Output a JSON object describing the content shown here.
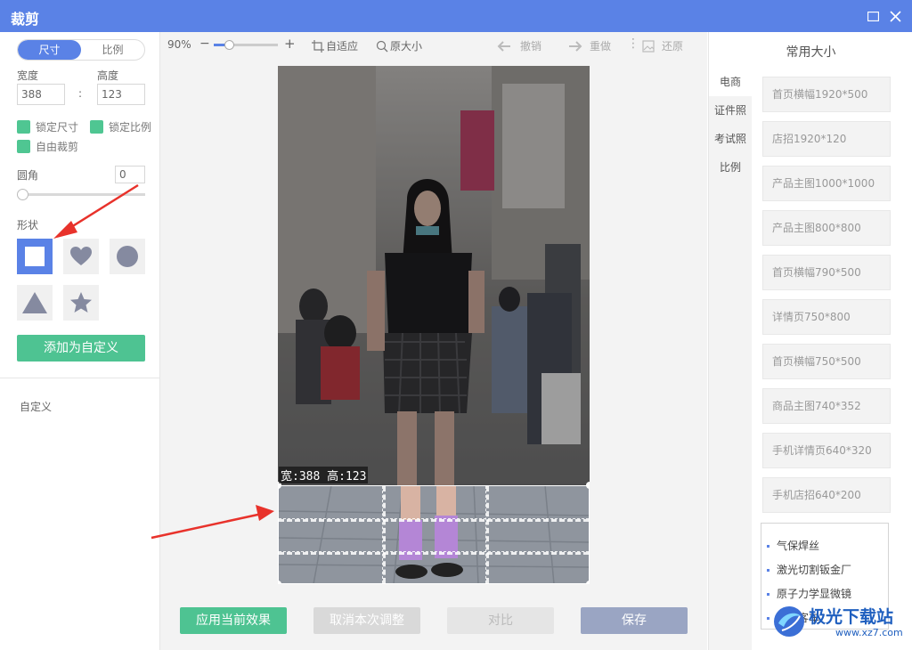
{
  "window": {
    "title": "裁剪"
  },
  "left": {
    "segment": {
      "size_label": "尺寸",
      "ratio_label": "比例"
    },
    "width_label": "宽度",
    "height_label": "高度",
    "width_value": "388",
    "height_value": "123",
    "separator": ":",
    "checks": {
      "lock_size": "锁定尺寸",
      "lock_ratio": "锁定比例",
      "free_crop": "自由裁剪"
    },
    "corner_label": "圆角",
    "corner_value": "0",
    "shape_label": "形状",
    "add_custom": "添加为自定义",
    "custom_label": "自定义"
  },
  "toolbar": {
    "zoom": "90%",
    "zoom_minus": "−",
    "zoom_plus": "+",
    "fit": "自适应",
    "original_size": "原大小",
    "undo": "撤销",
    "redo": "重做",
    "restore": "还原"
  },
  "canvas": {
    "size_readout": "宽:388 高:123"
  },
  "actions": {
    "apply": "应用当前效果",
    "cancel": "取消本次调整",
    "compare": "对比",
    "save": "保存"
  },
  "right": {
    "title": "常用大小",
    "tabs": [
      "电商",
      "证件照",
      "考试照",
      "比例"
    ],
    "presets": [
      "首页横幅1920*500",
      "店招1920*120",
      "产品主图1000*1000",
      "产品主图800*800",
      "首页横幅790*500",
      "详情页750*800",
      "首页横幅750*500",
      "商品主图740*352",
      "手机详情页640*320",
      "手机店招640*200"
    ],
    "ad_items": [
      "气保焊丝",
      "激光切割钣金厂",
      "原子力学显微镜",
      "宇通客车"
    ]
  },
  "watermark": {
    "brand": "极光下载站",
    "url": "www.xz7.com"
  },
  "colors": {
    "accent": "#5a82e6",
    "green": "#4ec392",
    "arrow": "#e8322b"
  }
}
